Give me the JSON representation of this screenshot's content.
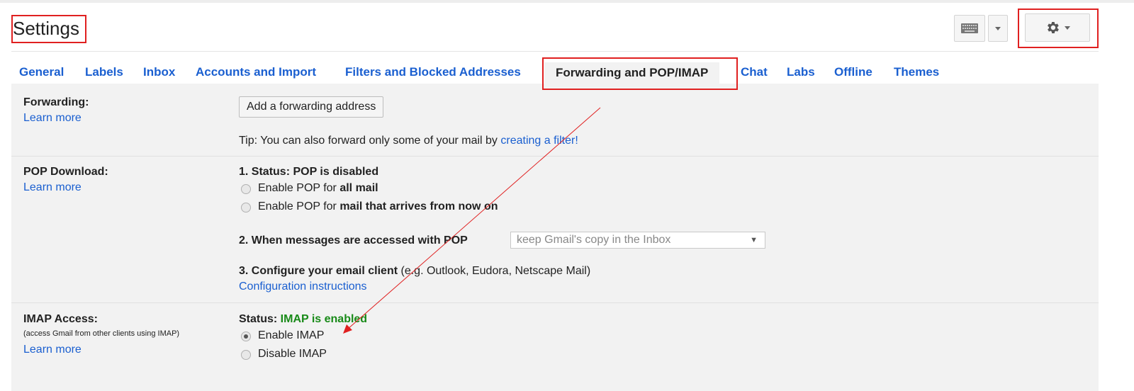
{
  "header": {
    "title": "Settings",
    "keyboard_icon": "keyboard-icon",
    "gear_icon": "gear-icon"
  },
  "tabs": [
    {
      "label": "General"
    },
    {
      "label": "Labels"
    },
    {
      "label": "Inbox"
    },
    {
      "label": "Accounts and Import"
    },
    {
      "label": "Filters and Blocked Addresses"
    },
    {
      "label": "Forwarding and POP/IMAP",
      "active": true
    },
    {
      "label": "Chat"
    },
    {
      "label": "Labs"
    },
    {
      "label": "Offline"
    },
    {
      "label": "Themes"
    }
  ],
  "forwarding": {
    "label": "Forwarding:",
    "learn_more": "Learn more",
    "add_button": "Add a forwarding address",
    "tip_prefix": "Tip: You can also forward only some of your mail by ",
    "tip_link": "creating a filter!"
  },
  "pop": {
    "label": "POP Download:",
    "learn_more": "Learn more",
    "status_heading": "1. Status: POP is disabled",
    "option1_prefix": "Enable POP for ",
    "option1_bold": "all mail",
    "option2_prefix": "Enable POP for ",
    "option2_bold": "mail that arrives from now on",
    "access_heading": "2. When messages are accessed with POP",
    "access_select": "keep Gmail's copy in the Inbox",
    "configure_heading": "3. Configure your email client",
    "configure_note": " (e.g. Outlook, Eudora, Netscape Mail)",
    "configure_link": "Configuration instructions"
  },
  "imap": {
    "label": "IMAP Access:",
    "sublabel": "(access Gmail from other clients using IMAP)",
    "learn_more": "Learn more",
    "status_prefix": "Status: ",
    "status_value": "IMAP is enabled",
    "enable": "Enable IMAP",
    "disable": "Disable IMAP",
    "selected": "Enable IMAP"
  },
  "colors": {
    "link": "#1a5fd0",
    "status_green": "#188a18",
    "annotation_red": "#e02020",
    "panel_bg": "#f2f2f2"
  }
}
